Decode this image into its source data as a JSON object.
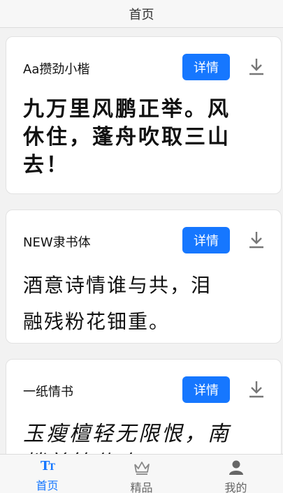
{
  "header": {
    "title": "首页"
  },
  "cards": [
    {
      "name": "Aa攒劲小楷",
      "detail_label": "详情",
      "sample": "九万里风鹏正举。风\n休住，蓬舟吹取三山\n去！"
    },
    {
      "name": "NEW隶书体",
      "detail_label": "详情",
      "sample": "酒意诗情谁与共，泪\n融残粉花钿重。"
    },
    {
      "name": "一纸情书",
      "detail_label": "详情",
      "sample": "玉瘦檀轻无限恨，南\n楼羌管休吹"
    }
  ],
  "icons": {
    "download": "download-icon",
    "home": "font-tt-icon",
    "featured": "crown-icon",
    "mine": "user-icon"
  },
  "colors": {
    "accent": "#1677ff",
    "background": "#f2f2f2"
  },
  "tabbar": {
    "items": [
      {
        "label": "首页",
        "active": true
      },
      {
        "label": "精品",
        "active": false
      },
      {
        "label": "我的",
        "active": false
      }
    ]
  }
}
